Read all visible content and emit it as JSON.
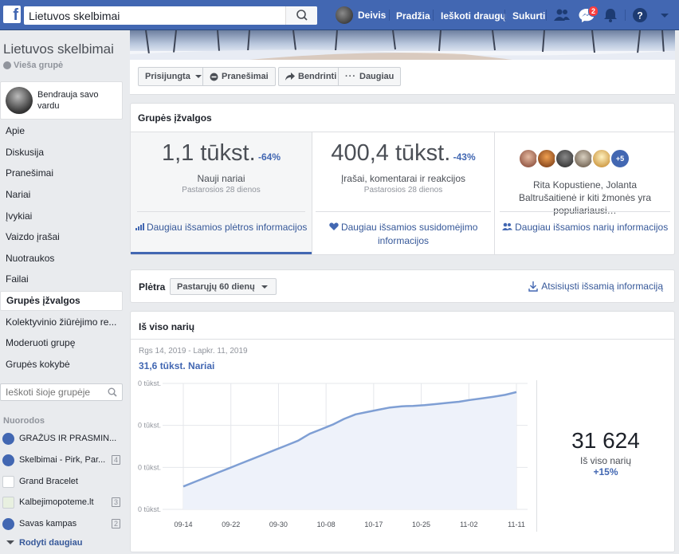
{
  "topbar": {
    "search_value": "Lietuvos skelbimai",
    "user_name": "Deivis",
    "nav_home": "Pradžia",
    "nav_find_friends": "Ieškoti draugų",
    "nav_create": "Sukurti",
    "messenger_badge": "2",
    "brand_color": "#4267b2"
  },
  "sidebar": {
    "group_name": "Lietuvos skelbimai",
    "group_type": "Vieša grupė",
    "identity_text": "Bendrauja savo vardu",
    "items": [
      {
        "label": "Apie"
      },
      {
        "label": "Diskusija"
      },
      {
        "label": "Pranešimai"
      },
      {
        "label": "Nariai"
      },
      {
        "label": "Įvykiai"
      },
      {
        "label": "Vaizdo įrašai"
      },
      {
        "label": "Nuotraukos"
      },
      {
        "label": "Failai"
      },
      {
        "label": "Grupės įžvalgos",
        "active": true
      },
      {
        "label": "Kolektyvinio žiūrėjimo re..."
      },
      {
        "label": "Moderuoti grupę"
      },
      {
        "label": "Grupės kokybė"
      }
    ],
    "search_placeholder": "Ieškoti šioje grupėje",
    "shortcuts_label": "Nuorodos",
    "shortcuts": [
      {
        "label": "GRAŽŪS IR PRASMIN...",
        "count": "",
        "icon": "group-icon"
      },
      {
        "label": "Skelbimai - Pirk, Par...",
        "count": "4",
        "icon": "group-icon"
      },
      {
        "label": "Grand Bracelet",
        "count": "",
        "icon": "page-icon"
      },
      {
        "label": "Kalbejimopoteme.lt",
        "count": "3",
        "icon": "page-icon"
      },
      {
        "label": "Savas kampas",
        "count": "2",
        "icon": "group-icon"
      }
    ],
    "show_more": "Rodyti daugiau"
  },
  "actionbar": {
    "joined": "Prisijungta",
    "notifications": "Pranešimai",
    "share": "Bendrinti",
    "more": "Daugiau"
  },
  "insights": {
    "title": "Grupės įžvalgos",
    "growth": {
      "value": "1,1 tūkst.",
      "change": "-64%",
      "label": "Nauji nariai",
      "period": "Pastarosios 28 dienos",
      "link": "Daugiau išsamios plėtros informacijos"
    },
    "engagement": {
      "value": "400,4 tūkst.",
      "change": "-43%",
      "label": "Įrašai, komentarai ir reakcijos",
      "period": "Pastarosios 28 dienos",
      "link": "Daugiau išsamios susidomėjimo informacijos"
    },
    "members": {
      "more_count": "+5",
      "text": "Rita Kopustiene, Jolanta Baltrušaitienė ir kiti žmonės yra populiariausi…",
      "link": "Daugiau išsamios narių informacijos"
    }
  },
  "growth_bar": {
    "title": "Plėtra",
    "period_select": "Pastarųjų 60 dienų",
    "download": "Atsisiųsti išsamią informaciją"
  },
  "total_members": {
    "title": "Iš viso narių",
    "range": "Rgs 14, 2019 - Lapkr. 11, 2019",
    "series_summary": "31,6 tūkst. Nariai",
    "big_value": "31 624",
    "big_label": "Iš viso narių",
    "big_change": "+15%"
  },
  "chart_data": {
    "type": "area",
    "title": "",
    "x_ticks": [
      "09-14",
      "09-22",
      "09-30",
      "10-08",
      "10-17",
      "10-25",
      "11-02",
      "11-11"
    ],
    "y_tick_labels": [
      "0 tūkst.",
      "0 tūkst.",
      "0 tūkst.",
      "0 tūkst."
    ],
    "series": [
      {
        "name": "Nariai",
        "color": "#7f9fd4",
        "x": [
          "09-14",
          "09-16",
          "09-18",
          "09-20",
          "09-22",
          "09-24",
          "09-26",
          "09-28",
          "09-30",
          "10-02",
          "10-04",
          "10-06",
          "10-08",
          "10-10",
          "10-12",
          "10-14",
          "10-16",
          "10-18",
          "10-20",
          "10-22",
          "10-24",
          "10-26",
          "10-28",
          "10-30",
          "11-01",
          "11-03",
          "11-05",
          "11-07",
          "11-09",
          "11-11"
        ],
        "values": [
          27.5,
          27.7,
          27.9,
          28.1,
          28.3,
          28.5,
          28.7,
          28.9,
          29.1,
          29.3,
          29.5,
          29.8,
          30.0,
          30.2,
          30.45,
          30.65,
          30.75,
          30.85,
          30.95,
          31.0,
          31.02,
          31.05,
          31.1,
          31.15,
          31.2,
          31.28,
          31.35,
          31.42,
          31.5,
          31.62
        ]
      }
    ],
    "grid": true,
    "legend": "none"
  }
}
